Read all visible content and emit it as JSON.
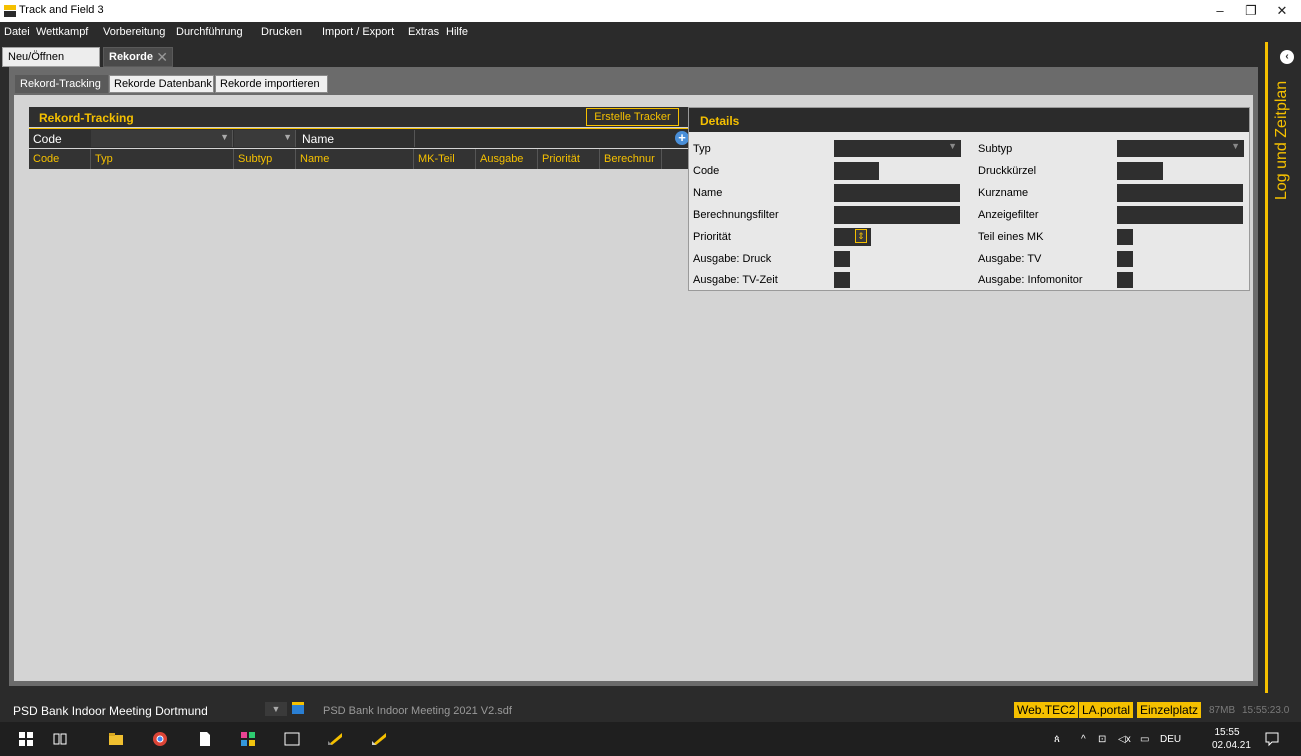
{
  "window": {
    "title": "Track and Field 3",
    "controls": {
      "minimize": "–",
      "maximize": "❐",
      "close": "✕"
    }
  },
  "menu": [
    "Datei",
    "Wettkampf",
    "Vorbereitung",
    "Durchführung",
    "Drucken",
    "Import / Export",
    "Extras",
    "Hilfe"
  ],
  "top_tabs": [
    {
      "label": "Neu/Öffnen",
      "active": false
    },
    {
      "label": "Rekorde",
      "active": true,
      "close": "✕"
    }
  ],
  "sub_tabs": [
    {
      "label": "Rekord-Tracking",
      "active": true
    },
    {
      "label": "Rekorde Datenbank",
      "active": false
    },
    {
      "label": "Rekorde importieren",
      "active": false
    }
  ],
  "rekord_tracking": {
    "title": "Rekord-Tracking",
    "button": "Erstelle Tracker",
    "filter": {
      "code_label": "Code",
      "name_label": "Name"
    },
    "columns": [
      "Code",
      "Typ",
      "Subtyp",
      "Name",
      "MK-Teil",
      "Ausgabe",
      "Priorität",
      "Berechnur"
    ]
  },
  "details": {
    "title": "Details",
    "left": [
      "Typ",
      "Code",
      "Name",
      "Berechnungsfilter",
      "Priorität",
      "Ausgabe: Druck",
      "Ausgabe: TV-Zeit"
    ],
    "right": [
      "Subtyp",
      "Druckkürzel",
      "Kurzname",
      "Anzeigefilter",
      "Teil eines MK",
      "Ausgabe: TV",
      "Ausgabe: Infomonitor"
    ]
  },
  "side_panel": {
    "label": "Log und Zeitplan"
  },
  "status": {
    "meeting": "PSD Bank Indoor Meeting Dortmund",
    "file": "PSD Bank Indoor Meeting 2021 V2.sdf",
    "badges": [
      "Web.TEC2",
      "LA.portal",
      "Einzelplatz"
    ],
    "memory": "87MB",
    "time": "15:55:23.0"
  },
  "taskbar": {
    "language": "DEU",
    "time": "15:55",
    "date": "02.04.21"
  },
  "colors": {
    "accent": "#f5c000",
    "dark": "#2b2b2b",
    "panel": "#d4d4d4"
  }
}
